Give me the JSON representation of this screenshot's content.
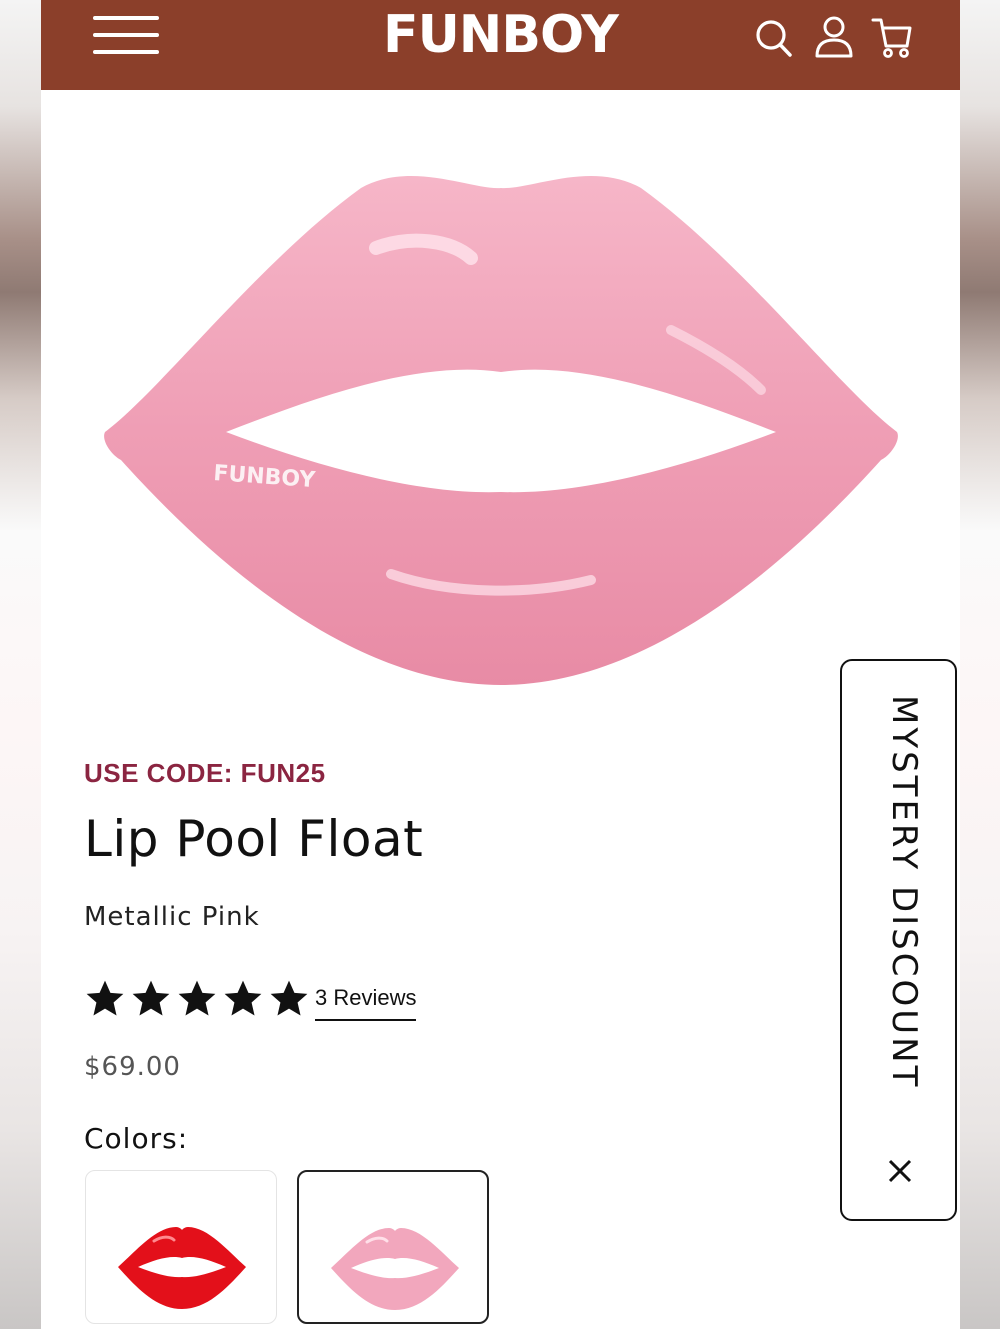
{
  "header": {
    "logo": "FUNBOY",
    "background_color": "#8b3f2a",
    "icons": [
      "menu-icon",
      "search-icon",
      "account-icon",
      "cart-icon"
    ]
  },
  "product": {
    "promo": "USE CODE: FUN25",
    "title": "Lip Pool Float",
    "variant": "Metallic Pink",
    "rating": 5,
    "rating_max": 5,
    "reviews_label": "3 Reviews",
    "price": "$69.00",
    "image_watermark": "FUNBOY",
    "image_color": "#f2a7bd"
  },
  "colors": {
    "label": "Colors:",
    "swatches": [
      {
        "name": "red",
        "color": "#e3101a",
        "selected": false
      },
      {
        "name": "pink",
        "color": "#f2a7bd",
        "selected": true
      }
    ]
  },
  "mystery": {
    "label": "MYSTERY DISCOUNT",
    "close": "✕"
  },
  "theme": {
    "promo_color": "#8b2541"
  }
}
